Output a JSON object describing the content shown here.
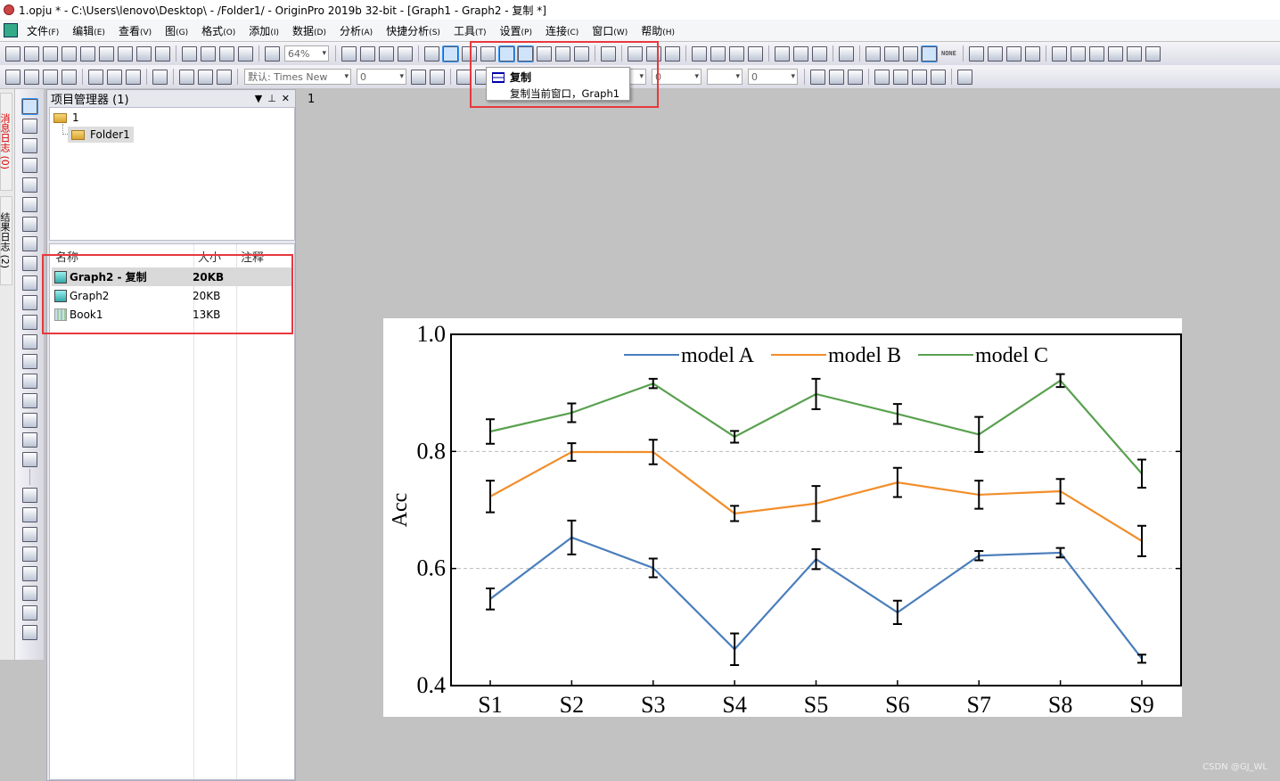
{
  "window_title": "1.opju * - C:\\Users\\lenovo\\Desktop\\ - /Folder1/ - OriginPro 2019b 32-bit - [Graph1 - Graph2 - 复制 *]",
  "menu": [
    {
      "label": "文件",
      "key": "(F)"
    },
    {
      "label": "编辑",
      "key": "(E)"
    },
    {
      "label": "查看",
      "key": "(V)"
    },
    {
      "label": "图",
      "key": "(G)"
    },
    {
      "label": "格式",
      "key": "(O)"
    },
    {
      "label": "添加",
      "key": "(I)"
    },
    {
      "label": "数据",
      "key": "(D)"
    },
    {
      "label": "分析",
      "key": "(A)"
    },
    {
      "label": "快捷分析",
      "key": "(S)"
    },
    {
      "label": "工具",
      "key": "(T)"
    },
    {
      "label": "设置",
      "key": "(P)"
    },
    {
      "label": "连接",
      "key": "(C)"
    },
    {
      "label": "窗口",
      "key": "(W)"
    },
    {
      "label": "帮助",
      "key": "(H)"
    }
  ],
  "toolbar": {
    "zoom": "64%",
    "font": "默认: Times New",
    "font_size": "0",
    "line_width": "0",
    "pattern_size": "0",
    "none_label": "NONE"
  },
  "tooltip": {
    "title": "复制",
    "desc": "复制当前窗口，Graph1"
  },
  "side_tabs": [
    "消息日志 (0)",
    "结果日志 (2)"
  ],
  "project_manager": {
    "title": "项目管理器 (1)",
    "root": "1",
    "folder": "Folder1",
    "columns": [
      "名称",
      "大小",
      "注释"
    ],
    "items": [
      {
        "name": "Graph2 - 复制",
        "size": "20KB",
        "type": "graph",
        "selected": true
      },
      {
        "name": "Graph2",
        "size": "20KB",
        "type": "graph"
      },
      {
        "name": "Book1",
        "size": "13KB",
        "type": "book"
      }
    ]
  },
  "workspace": {
    "layer_label": "1"
  },
  "watermark": "CSDN @GJ_WL",
  "colors": {
    "model_a": "#4a7ebb",
    "model_b": "#f28e2b",
    "model_c": "#59a14f",
    "highlight": "#e8383d"
  },
  "chart_data": {
    "type": "line",
    "categories": [
      "S1",
      "S2",
      "S3",
      "S4",
      "S5",
      "S6",
      "S7",
      "S8",
      "S9"
    ],
    "ylabel": "Acc",
    "xlabel": "",
    "ylim": [
      0.4,
      1.0
    ],
    "yticks": [
      "0.4",
      "0.6",
      "0.8",
      "1.0"
    ],
    "grid": "dashed at 0.6 and 0.8",
    "legend_position": "top-center",
    "series": [
      {
        "name": "model A",
        "values": [
          0.548,
          0.653,
          0.601,
          0.462,
          0.616,
          0.525,
          0.622,
          0.627,
          0.446
        ],
        "errors": [
          0.018,
          0.029,
          0.016,
          0.027,
          0.017,
          0.02,
          0.008,
          0.008,
          0.007
        ]
      },
      {
        "name": "model B",
        "values": [
          0.723,
          0.799,
          0.799,
          0.694,
          0.711,
          0.747,
          0.726,
          0.732,
          0.647
        ],
        "errors": [
          0.027,
          0.015,
          0.021,
          0.013,
          0.03,
          0.025,
          0.024,
          0.021,
          0.026
        ]
      },
      {
        "name": "model C",
        "values": [
          0.834,
          0.866,
          0.916,
          0.825,
          0.898,
          0.864,
          0.829,
          0.921,
          0.762
        ],
        "errors": [
          0.021,
          0.016,
          0.008,
          0.01,
          0.026,
          0.017,
          0.03,
          0.011,
          0.024
        ]
      }
    ]
  }
}
